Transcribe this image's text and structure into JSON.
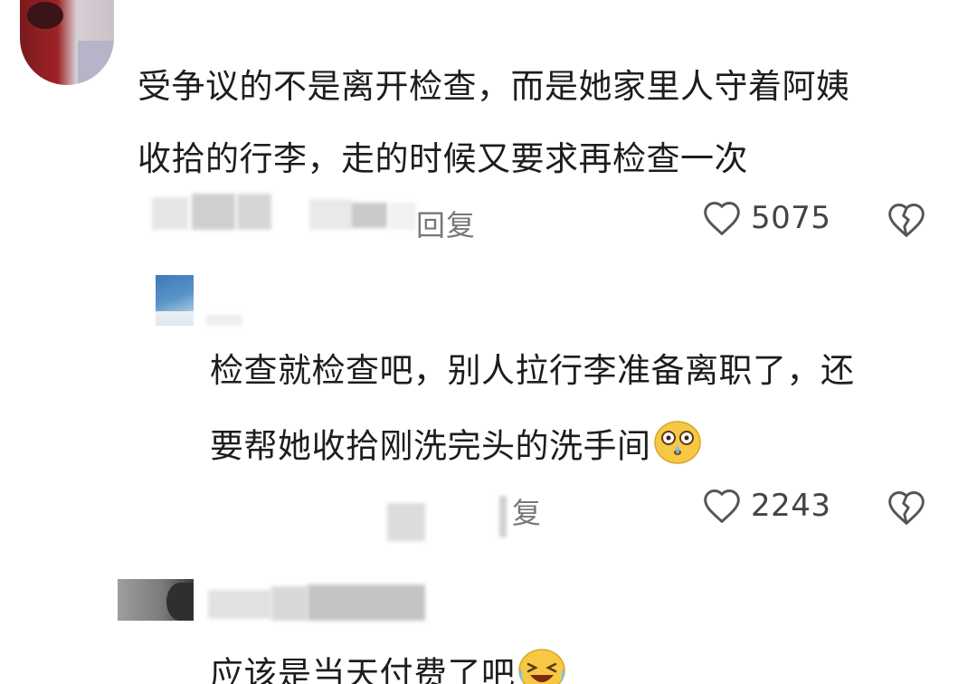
{
  "comments": [
    {
      "text_lines": [
        "受争议的不是离开检查，而是她家里人守着阿姨",
        "收拾的行李，走的时候又要求再检查一次"
      ],
      "reply_label": "回复",
      "likes": "5075"
    },
    {
      "text_lines": [
        "检查就检查吧，别人拉行李准备离职了，还",
        "要帮她收拾刚洗完头的洗手间"
      ],
      "reply_label": "复",
      "likes": "2243",
      "trailing_emoji": "crying-face-emoji"
    },
    {
      "text_lines": [
        "应该是当天付费了吧"
      ],
      "trailing_emoji": "laughing-tears-emoji"
    }
  ],
  "icons": {
    "like": "heart-outline-icon",
    "dislike": "broken-heart-icon"
  },
  "colors": {
    "text": "#1d1d1d",
    "meta": "#777777",
    "icon": "#555555",
    "emoji_yellow": "#f7c844"
  }
}
